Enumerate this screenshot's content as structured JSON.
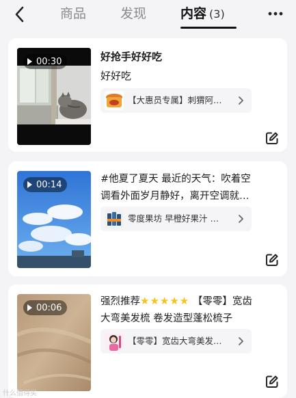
{
  "header": {
    "tabs": [
      {
        "label": "商品"
      },
      {
        "label": "发现"
      },
      {
        "label": "内容",
        "count": "(3)"
      }
    ]
  },
  "items": [
    {
      "duration": "00:30",
      "title": "好抢手好好吃",
      "description": "好好吃",
      "product": "【大惠员专属】刺猬阿…"
    },
    {
      "duration": "00:14",
      "text": "#他夏了夏天 最近的天气：吹着空调看外面岁月静好，离开空调就像被太阳烤了一样",
      "product": "零度果坊 早橙好果汁 …"
    },
    {
      "duration": "00:06",
      "text_prefix": "强烈推荐",
      "stars": "★★★★★",
      "text_suffix": " 【零零】宽齿大弯美发梳 卷发造型蓬松梳子",
      "product": "【零零】宽齿大弯美发…"
    }
  ],
  "watermark": "什么值得买"
}
